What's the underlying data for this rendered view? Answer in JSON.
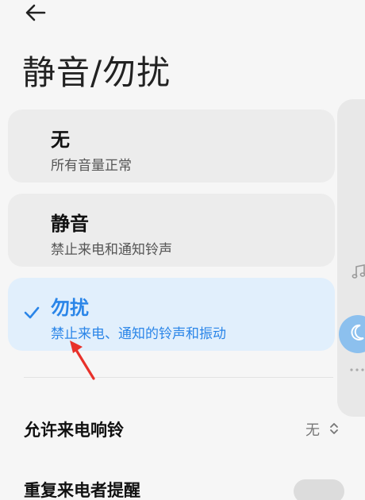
{
  "header": {
    "title": "静音/勿扰"
  },
  "options": [
    {
      "title": "无",
      "subtitle": "所有音量正常",
      "selected": false
    },
    {
      "title": "静音",
      "subtitle": "禁止来电和通知铃声",
      "selected": false
    },
    {
      "title": "勿扰",
      "subtitle": "禁止来电、通知的铃声和振动",
      "selected": true
    }
  ],
  "settings": {
    "allow_ring_label": "允许来电响铃",
    "allow_ring_value": "无",
    "repeat_caller_label": "重复来电者提醒"
  },
  "colors": {
    "accent": "#2a85e8",
    "selected_card": "#e1effc",
    "card": "#ececec",
    "annotation_arrow": "#e8312a"
  },
  "icons": {
    "back": "arrow-left-icon",
    "check": "check-icon",
    "up_down": "chevron-up-down-icon",
    "music": "music-note-icon",
    "moon": "moon-icon",
    "more": "more-dots-icon"
  }
}
